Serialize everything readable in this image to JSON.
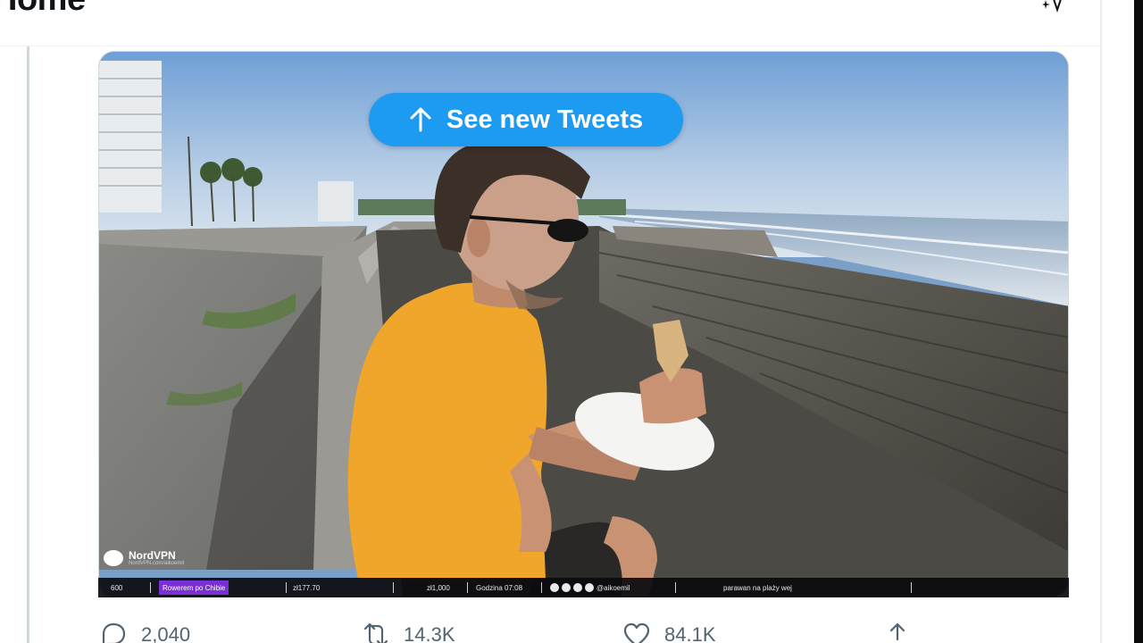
{
  "header": {
    "title": "Home",
    "sparkle_icon": "sparkle-icon"
  },
  "banner": {
    "label": "See new Tweets",
    "icon": "arrow-up-icon",
    "color": "#1d9bf0"
  },
  "video_overlay": {
    "brand": "NordVPN",
    "brand_sub": "NordVPN.com/aikoemil",
    "viewers": "600",
    "task": "Rowerem po Chibie",
    "distance_1": "zł177.70",
    "distance_2": "zł1,000",
    "time": "Godzina 07:08",
    "handle": "@aikoemil",
    "ticker": "parawan na plaży wej"
  },
  "actions": {
    "reply_count": "2,040",
    "retweet_count": "14.3K",
    "like_count": "84.1K",
    "reply_icon": "reply-icon",
    "retweet_icon": "retweet-icon",
    "like_icon": "heart-icon",
    "share_icon": "share-icon"
  },
  "colors": {
    "accent": "#1d9bf0",
    "icon_gray": "#536471"
  }
}
